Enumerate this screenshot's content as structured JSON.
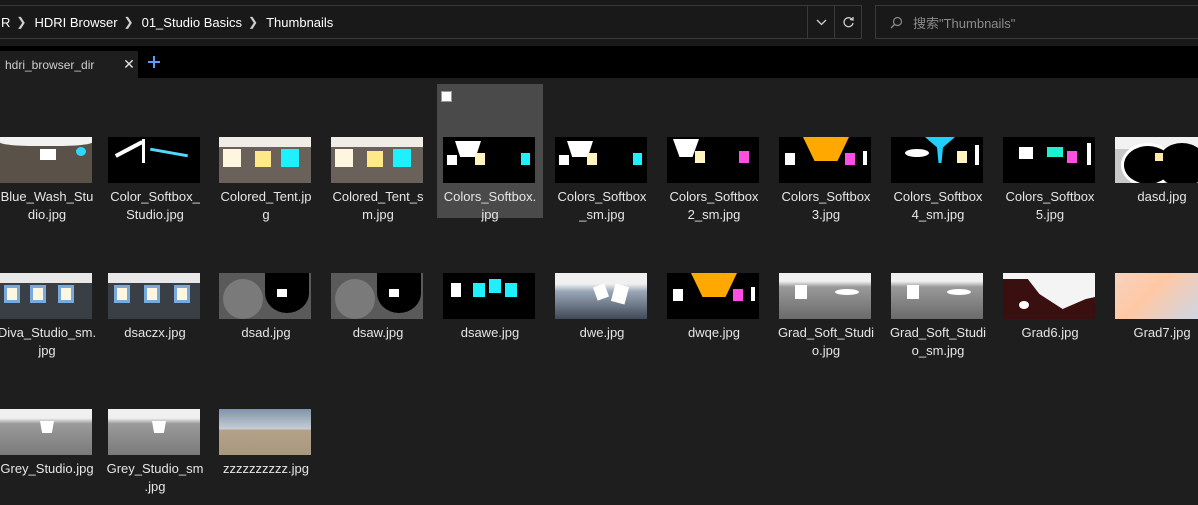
{
  "breadcrumb": [
    "R",
    "HDRI Browser",
    "01_Studio Basics",
    "Thumbnails"
  ],
  "search": {
    "placeholder": "搜索\"Thumbnails\""
  },
  "tab": {
    "label": "hdri_browser_dir"
  },
  "icons": {
    "dropdown": "chevron-down-icon",
    "refresh": "refresh-icon",
    "search": "search-icon",
    "close": "close-icon",
    "add": "add-tab-icon"
  },
  "colors": {
    "accent": "#5a9cff",
    "selection": "#4a4a4a",
    "background": "#1e1e1e"
  },
  "files": [
    {
      "name": "Blue_Wash_Studio.jpg",
      "l1": "Blue_Wash_Stu",
      "l2": "dio.jpg"
    },
    {
      "name": "Color_Softbox_Studio.jpg",
      "l1": "Color_Softbox_",
      "l2": "Studio.jpg"
    },
    {
      "name": "Colored_Tent.jpg",
      "l1": "Colored_Tent.jp",
      "l2": "g"
    },
    {
      "name": "Colored_Tent_sm.jpg",
      "l1": "Colored_Tent_s",
      "l2": "m.jpg"
    },
    {
      "name": "Colors_Softbox.jpg",
      "l1": "Colors_Softbox.",
      "l2": "jpg",
      "selected": true
    },
    {
      "name": "Colors_Softbox_sm.jpg",
      "l1": "Colors_Softbox",
      "l2": "_sm.jpg"
    },
    {
      "name": "Colors_Softbox2_sm.jpg",
      "l1": "Colors_Softbox",
      "l2": "2_sm.jpg"
    },
    {
      "name": "Colors_Softbox3.jpg",
      "l1": "Colors_Softbox",
      "l2": "3.jpg"
    },
    {
      "name": "Colors_Softbox4_sm.jpg",
      "l1": "Colors_Softbox",
      "l2": "4_sm.jpg"
    },
    {
      "name": "Colors_Softbox5.jpg",
      "l1": "Colors_Softbox",
      "l2": "5.jpg"
    },
    {
      "name": "dasd.jpg",
      "l1": "dasd.jpg",
      "l2": ""
    },
    {
      "name": "Diva_Studio_sm.jpg",
      "l1": "Diva_Studio_sm.",
      "l2": "jpg"
    },
    {
      "name": "dsaczx.jpg",
      "l1": "dsaczx.jpg",
      "l2": ""
    },
    {
      "name": "dsad.jpg",
      "l1": "dsad.jpg",
      "l2": ""
    },
    {
      "name": "dsaw.jpg",
      "l1": "dsaw.jpg",
      "l2": ""
    },
    {
      "name": "dsawe.jpg",
      "l1": "dsawe.jpg",
      "l2": ""
    },
    {
      "name": "dwe.jpg",
      "l1": "dwe.jpg",
      "l2": ""
    },
    {
      "name": "dwqe.jpg",
      "l1": "dwqe.jpg",
      "l2": ""
    },
    {
      "name": "Grad_Soft_Studio.jpg",
      "l1": "Grad_Soft_Studi",
      "l2": "o.jpg"
    },
    {
      "name": "Grad_Soft_Studio_sm.jpg",
      "l1": "Grad_Soft_Studi",
      "l2": "o_sm.jpg"
    },
    {
      "name": "Grad6.jpg",
      "l1": "Grad6.jpg",
      "l2": ""
    },
    {
      "name": "Grad7.jpg",
      "l1": "Grad7.jpg",
      "l2": ""
    },
    {
      "name": "Grey_Studio.jpg",
      "l1": "Grey_Studio.jpg",
      "l2": ""
    },
    {
      "name": "Grey_Studio_sm.jpg",
      "l1": "Grey_Studio_sm",
      "l2": ".jpg"
    },
    {
      "name": "zzzzzzzzzz.jpg",
      "l1": "zzzzzzzzzz.jpg",
      "l2": ""
    }
  ]
}
